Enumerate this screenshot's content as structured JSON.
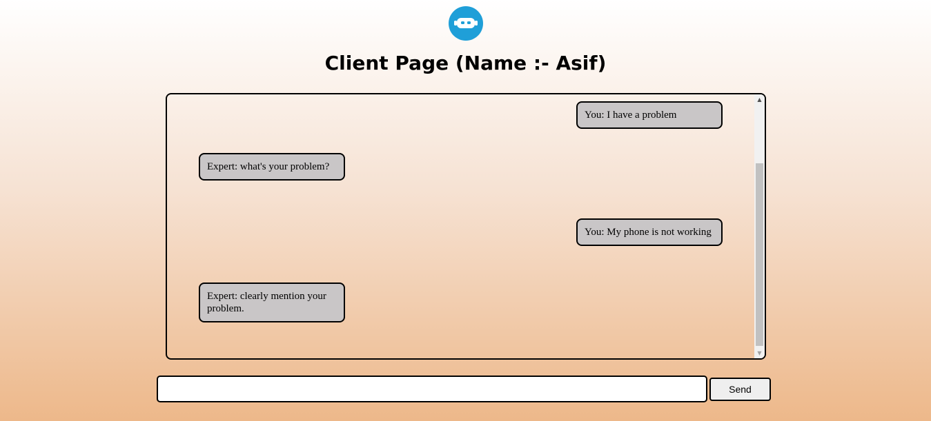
{
  "header": {
    "logo_icon": "robot-face-icon",
    "title": "Client Page (Name :- Asif)"
  },
  "chat": {
    "messages": [
      {
        "sender": "you",
        "text": "You: I have a problem"
      },
      {
        "sender": "expert",
        "text": "Expert: what's your problem?"
      },
      {
        "sender": "you",
        "text": "You: My phone is not working"
      },
      {
        "sender": "expert",
        "text": "Expert: clearly mention your problem."
      }
    ],
    "bubble_color": "#c9c6c7"
  },
  "composer": {
    "input_value": "",
    "send_label": "Send"
  },
  "colors": {
    "accent": "#1f9fd8",
    "background_bottom": "#edb88a"
  }
}
